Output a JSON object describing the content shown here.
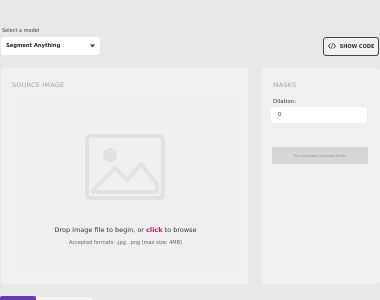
{
  "model": {
    "label": "Select a model",
    "selected": "Segment Anything"
  },
  "toolbar": {
    "show_code_label": "SHOW CODE"
  },
  "source": {
    "title": "SOURCE IMAGE",
    "drop_prefix": "Drop image file to begin, or ",
    "drop_link": "click",
    "drop_suffix": " to browse",
    "formats": "Accepted formats: .jpg, .png (max size: 4MB)"
  },
  "masks": {
    "title": "MASKS",
    "dilation_label": "Dilation:",
    "dilation_value": "0",
    "run_label": "Run Segment Anything Model"
  },
  "colors": {
    "accent": "#c2185b",
    "tab_active": "#6a3ab6"
  },
  "icons": {
    "select_arrow": "chevron-down-icon",
    "code": "code-icon",
    "placeholder": "image-icon"
  }
}
